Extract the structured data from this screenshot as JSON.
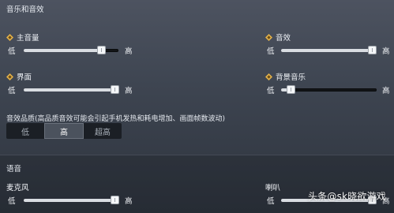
{
  "sections": {
    "music_title": "音乐和音效",
    "voice_title": "语音"
  },
  "labels": {
    "low": "低",
    "high": "高"
  },
  "sliders": {
    "main_volume": {
      "label": "主音量",
      "value": 0.82
    },
    "sound_effects": {
      "label": "音效",
      "value": 1.0
    },
    "interface": {
      "label": "界面",
      "value": 1.0
    },
    "background_music": {
      "label": "背景音乐",
      "value": 0.1
    },
    "microphone": {
      "label": "麦克风",
      "value": 1.0
    },
    "speaker": {
      "label": "喇叭",
      "value": 1.0
    }
  },
  "audio_quality": {
    "description": "音效品质(高品质音效可能会引起手机发热和耗电增加、画面帧数波动)",
    "options": [
      "低",
      "高",
      "超高"
    ],
    "selected": "高"
  },
  "watermark": "头条@sk晓欲游戏",
  "colors": {
    "accent_icon": "#e4b24a",
    "slider_fill": "#d9dde2",
    "track": "#121417"
  },
  "icons": {
    "setting_icon": "diamond-icon"
  }
}
